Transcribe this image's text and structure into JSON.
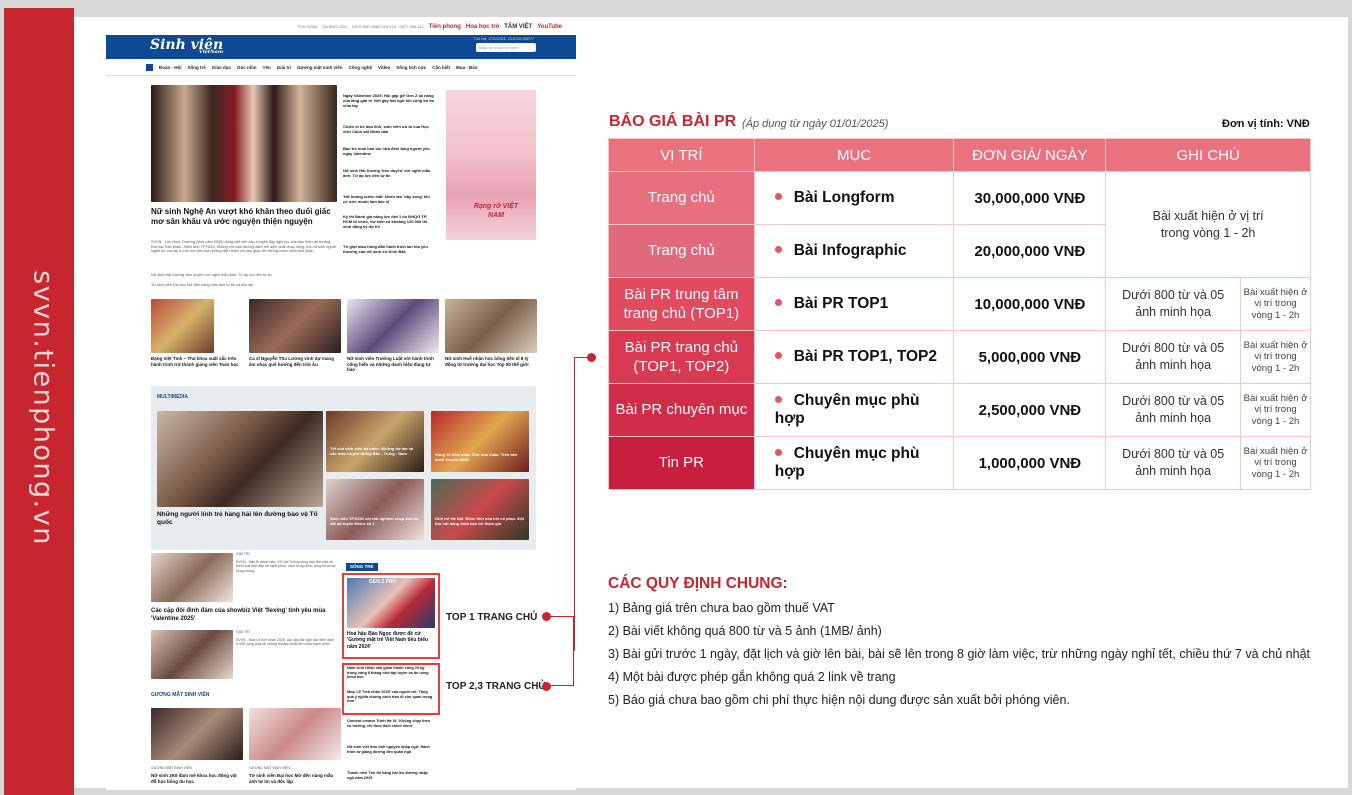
{
  "sidebar_text": "svvn.tienphong.vn",
  "website": {
    "top_links": [
      "TÒA SOẠN",
      "QUẢNG CÁO",
      "HOTLINE: 0983.015.015 - 0977.456.112"
    ],
    "partner_logos": [
      "Tiền phong",
      "Hoa học trò",
      "TÂM VIỆT",
      "YouTube"
    ],
    "logo": "Sinh viên",
    "logo_sub": "ViệtNam",
    "date": "Thứ Hai, 17/02/2025, 15:40:06 GMT+7",
    "search_placeholder": "Nhập từ khóa tìm kiếm",
    "nav": [
      "Đoàn - Hội",
      "Sống trẻ",
      "Giáo dục",
      "Góc nhìn",
      "Yêu",
      "Giải trí",
      "Gương mặt sinh viên",
      "Công nghệ",
      "Video",
      "Sống tích cực",
      "Cần biết",
      "Mua - Bán"
    ],
    "lead_title": "Nữ sinh Nghệ An vượt khó khăn theo đuổi giấc mơ sân khấu và ước nguyện thiện nguyện",
    "lead_desc": "SVVN - Lưu Hoài Thương (sinh năm 2005) đang viết nên câu chuyện đầy nghị lực của bản thân tại trường Đại học Sân khấu - Điện ảnh TP.HCM. Không chỉ nuôi dưỡng đam mê diễn xuất chày bỏng, mà nữ sinh người Nghệ An còn ấp ủ ước mơ làm tòa những điều thiện chí sau giúp đỡ những hoàn cảnh khó khăn.",
    "lead_bullets": [
      "Nữ sinh Hải Dương 'bén duyên' với nghề mẫu ảnh: Từ áp lực đến tự tin",
      "Từ sinh viên Đại học Mở đến nàng mẫu ảnh tự tin và độc lập"
    ],
    "side_news": [
      "Ngày Valentine 2025: Hội gặp gỡ Gen Z lại nâng của lăng giải trí Việt gây bất ngờ khi công bố tin chia tay",
      "Chiến sĩ trẻ bản lĩnh, sinh viên ưu tú của Học viện Cảnh sát Nhân dân",
      "Bạn trẻ mua hoa lúc nửa đêm tặng người yêu ngày Valentine",
      "Nữ sinh Hải Dương 'bén duyên' với nghề mẫu ảnh: Từ áp lực đến tự tin",
      "'Nữ hoàng nước mắt' khiến fan 'dậy sóng' khi có ước muốn làm bác sĩ",
      "Kỳ thi Đánh giá năng lực đợt 1 do ĐHQG TP. HCM tổ chức, dự kiến có khoảng 120.000 thí sinh đăng ký dự thi",
      "Tờ giọt máu hồng dẫn hành trình lan tỏa yêu thương của nữ sinh xứ Kinh Bắc"
    ],
    "mag_title": "Rạng rỡ VIỆT NAM",
    "row_news": [
      "Đặng Việt Tình – Thủ khoa xuất sắc trên hành trình trở thành giảng viên Toán học",
      "Ca sĩ Nguyễn Thu Lương vinh dự mang âm nhạc quê hương đến trời Âu",
      "Nữ sinh viên Trường Luật với hành trình cống hiến và những danh hiệu đáng tự hào",
      "Nữ sinh Huế nhận học bổng tiến sĩ 8 tỷ đồng từ trường đại học Top 50 thế giới"
    ],
    "multimedia_label": "MULTIMEDIA",
    "mm_main": "Những người lính trẻ hàng hải lên đường bảo vệ Tổ quốc",
    "mm_items": [
      "Tết của sinh viên ba miền: Những dư âm và sắc màu truyền thống Bắc - Trung - Nam",
      "Vòng 10 đêm nhạc Chợ hoa Xuân 'Trên bến dưới thuyền 2025'",
      "Sinh viên TP.HCM với trải nghiệm chụp ảnh áo dài tại tuyến Metro số 1",
      "Giới trẻ Hà Nội: Điềm tĩnh hòa hết cổ phục Việt thu hút hàng trăm bạn trẻ tham gia"
    ],
    "lower_news": [
      "Các cặp đôi đình đám của showbiz Việt 'flexing' tình yêu mùa 'Valentine 2025'",
      "Nữ sinh 2K6 đam mê khoa học động vật đỗ học bổng du học",
      "Từ sinh viên Đại học Mở đến nàng mẫu ảnh tự tin và độc lập"
    ],
    "lower_tag": "GIẢI TRÍ",
    "lower_descs": [
      "SVVN - Hậu lễ thành hôn, Võ Cát Tường cùng bạn đời chia sẻ thêm loạt ảnh đẹp về hạnh phúc, chúc từng được công bố trước công chúng.",
      "SVVN - Mùa Lễ tình nhân 2025, các cặp đôi ngôi sao đình đám ở Việt cùng chia sẻ những khoảnh khắc lên nhau hạnh phúc."
    ],
    "gmsv_label": "GƯƠNG MẶT SINH VIÊN",
    "gmsv_tag": "GƯƠNG MẶT SINH VIÊN",
    "song_tre_label": "SỐNG TRẺ",
    "gen_label": "GEN Z PRO",
    "top1_title": "Hoa hậu Bảo Ngọc được đề cử 'Gương mặt trẻ Việt Nam tiêu biểu năm 2024'",
    "top23": [
      "Nam sinh Nhân văn giảm thành công 20 kg trong vòng 8 tháng nhờ tập luyện và ăn uống khoa học",
      "Mùa 'Lễ Tình nhân 2025' của người trẻ: Tặng quà ý nghĩa nhưng cách trao đi còn quan trọng hơn"
    ],
    "top_more": [
      "Content creator Trịnh Hà Vi: 'Không chạy theo xu hướng, chỉ theo đuổi chính mình'",
      "Nữ sinh viết đơn tình nguyện nhập ngũ: Hành trình từ giảng đường đến quân ngũ",
      "Thanh niên Thủ đô hăng hái lên đường nhập ngũ năm 2025"
    ],
    "top1_label": "TOP 1 TRANG CHỦ",
    "top23_label": "TOP 2,3 TRANG CHỦ"
  },
  "pricing": {
    "title": "BÁO GIÁ BÀI PR",
    "subtitle": "(Áp dụng từ ngày 01/01/2025)",
    "unit": "Đơn vị tính: VNĐ",
    "headers": [
      "VỊ TRÍ",
      "MỤC",
      "ĐƠN GIÁ/ NGÀY",
      "GHI CHÚ"
    ],
    "rows": [
      {
        "pos": "Trang chủ",
        "item": "Bài Longform",
        "price": "30,000,000 VNĐ"
      },
      {
        "pos": "Trang chủ",
        "item": "Bài Infographic",
        "price": "20,000,000 VNĐ"
      },
      {
        "pos": "Bài PR trung tâm trang chủ (TOP1)",
        "item": "Bài PR TOP1",
        "price": "10,000,000 VNĐ",
        "note1": "Dưới 800 từ và 05 ảnh minh họa",
        "note2": "Bài xuất hiện ở vị trí trong vòng 1 - 2h"
      },
      {
        "pos": "Bài PR trang chủ (TOP1, TOP2)",
        "item": "Bài PR TOP1, TOP2",
        "price": "5,000,000 VNĐ",
        "note1": "Dưới 800 từ và 05 ảnh minh họa",
        "note2": "Bài xuất hiện ở vị trí trong vòng 1 - 2h"
      },
      {
        "pos": "Bài PR chuyên mục",
        "item": "Chuyên mục phù hợp",
        "price": "2,500,000 VNĐ",
        "note1": "Dưới 800 từ và 05 ảnh minh họa",
        "note2": "Bài xuất hiện ở vị trí trong vòng 1 - 2h"
      },
      {
        "pos": "Tin PR",
        "item": "Chuyên mục phù hợp",
        "price": "1,000,000 VNĐ",
        "note1": "Dưới 800 từ và 05 ảnh minh họa",
        "note2": "Bài xuất hiện ở vị trí trong vòng 1 - 2h"
      }
    ],
    "merged_note": "Bài xuất hiện ở vị trí trong vòng 1 - 2h",
    "pos_colors": [
      "#e76f7f",
      "#e06a7b",
      "#e24a60",
      "#d83a52",
      "#cf2d49",
      "#c81f3e"
    ]
  },
  "rules": {
    "title": "CÁC QUY ĐỊNH CHUNG:",
    "items": [
      "1) Bảng giá trên chưa bao gồm thuế VAT",
      "2) Bài viết không quá 800 từ và 5 ảnh (1MB/ ảnh)",
      "3) Bài gửi trước 1 ngày, đặt lịch và giờ lên bài, bài sẽ lên trong 8 giờ làm việc, trừ những ngày nghỉ tết, chiều thứ 7 và chủ nhật",
      "4) Một bài được phép gắn không quá 2 link về trang",
      "5) Báo giá chưa bao gồm chi phí thực hiện nội dung được sản xuất bởi phóng viên."
    ]
  }
}
